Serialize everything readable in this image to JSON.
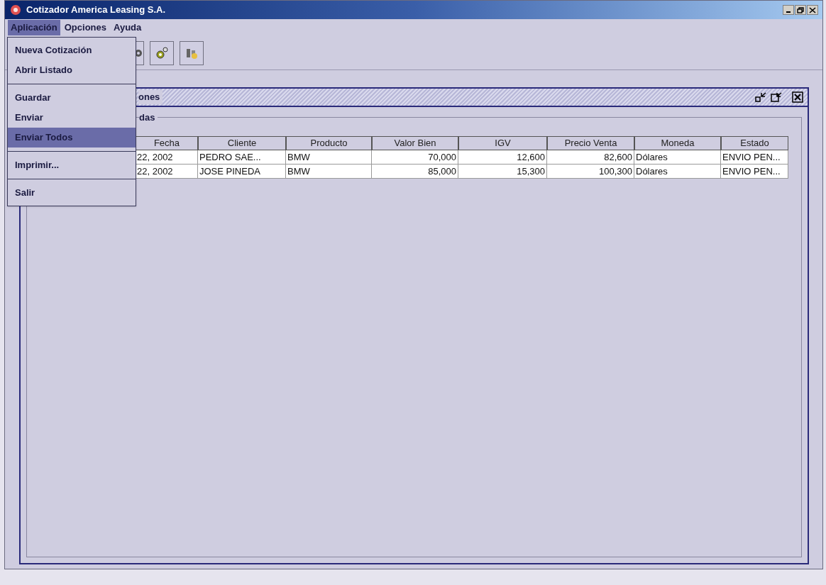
{
  "window": {
    "title": "Cotizador America Leasing S.A."
  },
  "menu_bar": [
    {
      "label": "Aplicación",
      "selected": true
    },
    {
      "label": "Opciones",
      "selected": false
    },
    {
      "label": "Ayuda",
      "selected": false
    }
  ],
  "open_menu": [
    {
      "kind": "item",
      "label": "Nueva Cotización",
      "selected": false
    },
    {
      "kind": "item",
      "label": "Abrir Listado",
      "selected": false
    },
    {
      "kind": "separator"
    },
    {
      "kind": "item",
      "label": "Guardar",
      "selected": false
    },
    {
      "kind": "item",
      "label": "Enviar",
      "selected": false
    },
    {
      "kind": "item",
      "label": "Enviar Todos",
      "selected": true
    },
    {
      "kind": "separator"
    },
    {
      "kind": "item",
      "label": "Imprimir...",
      "selected": false
    },
    {
      "kind": "separator"
    },
    {
      "kind": "item",
      "label": "Salir",
      "selected": false
    }
  ],
  "inner_frame": {
    "title": "ones",
    "group_label": "das"
  },
  "table": {
    "columns": [
      "Fecha",
      "Cliente",
      "Producto",
      "Valor Bien",
      "IGV",
      "Precio Venta",
      "Moneda",
      "Estado"
    ],
    "rows": [
      [
        "22, 2002",
        "PEDRO SAE...",
        "BMW",
        "70,000",
        "12,600",
        "82,600",
        "Dólares",
        "ENVIO PEN..."
      ],
      [
        "22, 2002",
        "JOSE PINEDA",
        "BMW",
        "85,000",
        "15,300",
        "100,300",
        "Dólares",
        "ENVIO PEN..."
      ]
    ]
  }
}
